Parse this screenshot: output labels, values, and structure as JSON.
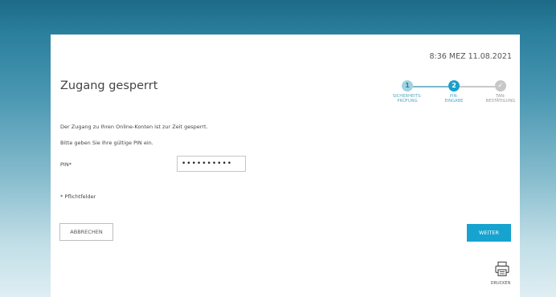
{
  "header": {
    "datetime": "8:36 MEZ 11.08.2021"
  },
  "page": {
    "title": "Zugang gesperrt"
  },
  "steps": [
    {
      "number": "1",
      "label_line1": "SICHERHEITS-",
      "label_line2": "PRÜFUNG",
      "state": "done"
    },
    {
      "number": "2",
      "label_line1": "PIN-",
      "label_line2": "EINGABE",
      "state": "active"
    },
    {
      "number": "✓",
      "label_line1": "TAN-",
      "label_line2": "BESTÄTIGUNG",
      "state": "pending"
    }
  ],
  "messages": {
    "locked": "Der Zugang zu Ihren Online-Konten ist zur Zeit gesperrt.",
    "instruction": "Bitte geben Sie Ihre gültige PIN ein."
  },
  "form": {
    "pin_label": "PIN*",
    "pin_value": "••••••••••"
  },
  "required_note": "* Pflichtfelder",
  "buttons": {
    "cancel": "ABBRECHEN",
    "next": "WEITER"
  },
  "print": {
    "label": "DRUCKEN",
    "icon": "printer-icon"
  },
  "colors": {
    "accent": "#17a3cf",
    "step_done": "#9fd3e3",
    "step_pending": "#c7c7c7"
  }
}
